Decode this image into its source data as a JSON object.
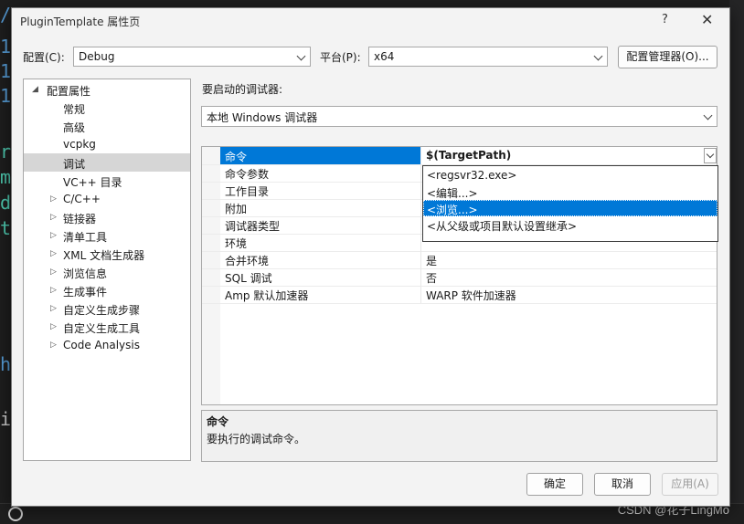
{
  "background": {
    "glyphs": [
      "/",
      "1",
      "1",
      "1",
      "r",
      "m",
      "d",
      "t",
      "h",
      "i"
    ]
  },
  "window": {
    "title": "PluginTemplate 属性页",
    "help": "?",
    "close": "✕"
  },
  "config_bar": {
    "config_label": "配置(C):",
    "config_value": "Debug",
    "platform_label": "平台(P):",
    "platform_value": "x64",
    "manager_button": "配置管理器(O)..."
  },
  "tree": {
    "root": "配置属性",
    "items": [
      {
        "label": "常规",
        "expandable": false,
        "selected": false
      },
      {
        "label": "高级",
        "expandable": false,
        "selected": false
      },
      {
        "label": "vcpkg",
        "expandable": false,
        "selected": false
      },
      {
        "label": "调试",
        "expandable": false,
        "selected": true
      },
      {
        "label": "VC++ 目录",
        "expandable": false,
        "selected": false
      },
      {
        "label": "C/C++",
        "expandable": true,
        "selected": false
      },
      {
        "label": "链接器",
        "expandable": true,
        "selected": false
      },
      {
        "label": "清单工具",
        "expandable": true,
        "selected": false
      },
      {
        "label": "XML 文档生成器",
        "expandable": true,
        "selected": false
      },
      {
        "label": "浏览信息",
        "expandable": true,
        "selected": false
      },
      {
        "label": "生成事件",
        "expandable": true,
        "selected": false
      },
      {
        "label": "自定义生成步骤",
        "expandable": true,
        "selected": false
      },
      {
        "label": "自定义生成工具",
        "expandable": true,
        "selected": false
      },
      {
        "label": "Code Analysis",
        "expandable": true,
        "selected": false
      }
    ]
  },
  "debugger": {
    "label": "要启动的调试器:",
    "value": "本地 Windows 调试器"
  },
  "properties": [
    {
      "name": "命令",
      "value": "$(TargetPath)"
    },
    {
      "name": "命令参数",
      "value": ""
    },
    {
      "name": "工作目录",
      "value": ""
    },
    {
      "name": "附加",
      "value": ""
    },
    {
      "name": "调试器类型",
      "value": ""
    },
    {
      "name": "环境",
      "value": ""
    },
    {
      "name": "合并环境",
      "value": "是"
    },
    {
      "name": "SQL 调试",
      "value": "否"
    },
    {
      "name": "Amp 默认加速器",
      "value": "WARP 软件加速器"
    }
  ],
  "dropdown": {
    "options": [
      "<regsvr32.exe>",
      "<编辑...>",
      "<浏览...>",
      "<从父级或项目默认设置继承>"
    ],
    "highlighted": 2
  },
  "description": {
    "title": "命令",
    "body": "要执行的调试命令。"
  },
  "buttons": {
    "ok": "确定",
    "cancel": "取消",
    "apply": "应用(A)"
  },
  "watermark": "CSDN @花子LingMo"
}
